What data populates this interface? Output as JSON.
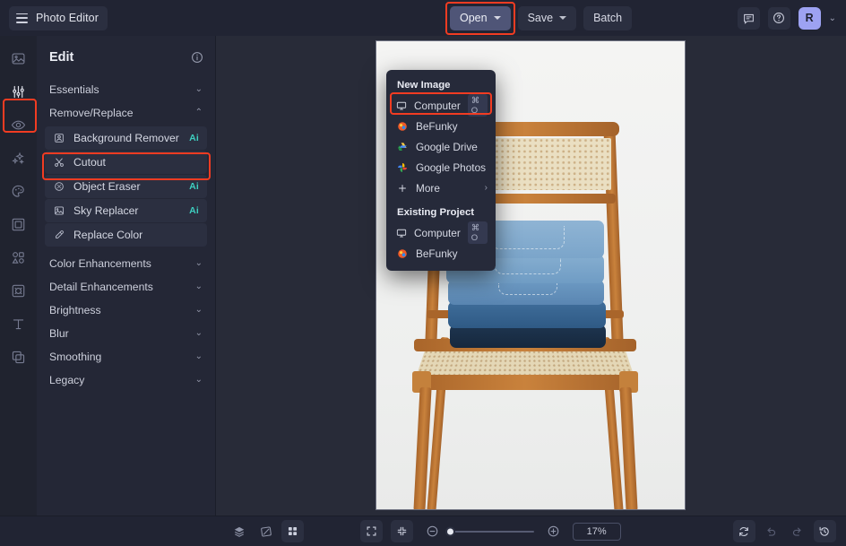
{
  "app": {
    "name": "Photo Editor",
    "menu_icon": "hamburger-icon"
  },
  "toolbar": {
    "open_label": "Open",
    "save_label": "Save",
    "batch_label": "Batch",
    "feedback_icon": "chat-bubble-icon",
    "help_icon": "question-circle-icon",
    "avatar_initial": "R",
    "avatar_chevron": "⌄"
  },
  "open_menu": {
    "new_image_header": "New Image",
    "existing_project_header": "Existing Project",
    "new_image_items": [
      {
        "label": "Computer",
        "icon": "monitor-icon",
        "shortcut": "⌘ O",
        "highlighted": true
      },
      {
        "label": "BeFunky",
        "icon": "befunky-logo-icon",
        "shortcut": ""
      },
      {
        "label": "Google Drive",
        "icon": "google-drive-icon",
        "shortcut": ""
      },
      {
        "label": "Google Photos",
        "icon": "google-photos-icon",
        "shortcut": ""
      },
      {
        "label": "More",
        "icon": "plus-icon",
        "shortcut": "",
        "submenu_arrow": "›"
      }
    ],
    "existing_project_items": [
      {
        "label": "Computer",
        "icon": "monitor-icon",
        "shortcut": "⌘ O"
      },
      {
        "label": "BeFunky",
        "icon": "befunky-logo-icon",
        "shortcut": ""
      }
    ]
  },
  "rail": {
    "items": [
      {
        "name": "image-tool",
        "icon": "photo-icon",
        "selected": false
      },
      {
        "name": "edit-tool",
        "icon": "sliders-icon",
        "selected": true
      },
      {
        "name": "retouch-tool",
        "icon": "eye-icon",
        "selected": false
      },
      {
        "name": "effects-tool",
        "icon": "sparkles-icon",
        "selected": false
      },
      {
        "name": "artsy-tool",
        "icon": "palette-icon",
        "selected": false
      },
      {
        "name": "frames-tool",
        "icon": "frame-icon",
        "selected": false
      },
      {
        "name": "overlays-tool",
        "icon": "shapes-icon",
        "selected": false
      },
      {
        "name": "textures-tool",
        "icon": "texture-icon",
        "selected": false
      },
      {
        "name": "text-tool",
        "icon": "text-t-icon",
        "selected": false
      },
      {
        "name": "graphics-tool",
        "icon": "layers-icon",
        "selected": false
      }
    ]
  },
  "panel": {
    "title": "Edit",
    "info_icon": "info-circle-icon",
    "groups": [
      {
        "label": "Essentials",
        "expanded": false,
        "chevron": "⌄",
        "items": []
      },
      {
        "label": "Remove/Replace",
        "expanded": true,
        "chevron": "⌃",
        "items": [
          {
            "label": "Background Remover",
            "icon": "person-portrait-icon",
            "badge": "Ai",
            "highlighted": true
          },
          {
            "label": "Cutout",
            "icon": "scissors-icon",
            "badge": ""
          },
          {
            "label": "Object Eraser",
            "icon": "eraser-circle-icon",
            "badge": "Ai"
          },
          {
            "label": "Sky Replacer",
            "icon": "mountain-sky-icon",
            "badge": "Ai"
          },
          {
            "label": "Replace Color",
            "icon": "eyedropper-icon",
            "badge": ""
          }
        ]
      },
      {
        "label": "Color Enhancements",
        "expanded": false,
        "chevron": "⌄",
        "items": []
      },
      {
        "label": "Detail Enhancements",
        "expanded": false,
        "chevron": "⌄",
        "items": []
      },
      {
        "label": "Brightness",
        "expanded": false,
        "chevron": "⌄",
        "items": []
      },
      {
        "label": "Blur",
        "expanded": false,
        "chevron": "⌄",
        "items": []
      },
      {
        "label": "Smoothing",
        "expanded": false,
        "chevron": "⌄",
        "items": []
      },
      {
        "label": "Legacy",
        "expanded": false,
        "chevron": "⌄",
        "items": []
      }
    ]
  },
  "canvas": {
    "image_description": "Stack of folded blue jeans on a wooden folding chair with cane seat and back, white background",
    "background_color": "#282b38"
  },
  "statusbar": {
    "left_icons": [
      {
        "name": "layers-panel-button",
        "icon": "stack-icon",
        "boxed": false
      },
      {
        "name": "compare-button",
        "icon": "compare-split-icon",
        "boxed": false
      },
      {
        "name": "grid-view-button",
        "icon": "grid-four-icon",
        "boxed": true
      }
    ],
    "fit_icon": "fit-screen-icon",
    "actual_size_icon": "collapse-arrows-icon",
    "zoom_out_icon": "minus-circle-icon",
    "zoom_in_icon": "plus-circle-icon",
    "zoom_value": "17%",
    "right_icons": [
      {
        "name": "reset-button",
        "icon": "refresh-icon",
        "boxed": true,
        "dim": false
      },
      {
        "name": "undo-button",
        "icon": "undo-arrow-icon",
        "boxed": false,
        "dim": true
      },
      {
        "name": "redo-button",
        "icon": "redo-arrow-icon",
        "boxed": false,
        "dim": true
      },
      {
        "name": "history-button",
        "icon": "history-clock-icon",
        "boxed": true,
        "dim": false
      }
    ]
  },
  "annotations": {
    "highlight_color": "#f23c22",
    "boxes": [
      {
        "target": "edit-tool-rail-icon"
      },
      {
        "target": "background-remover-item"
      },
      {
        "target": "open-button"
      },
      {
        "target": "open-menu-computer-item"
      }
    ]
  }
}
